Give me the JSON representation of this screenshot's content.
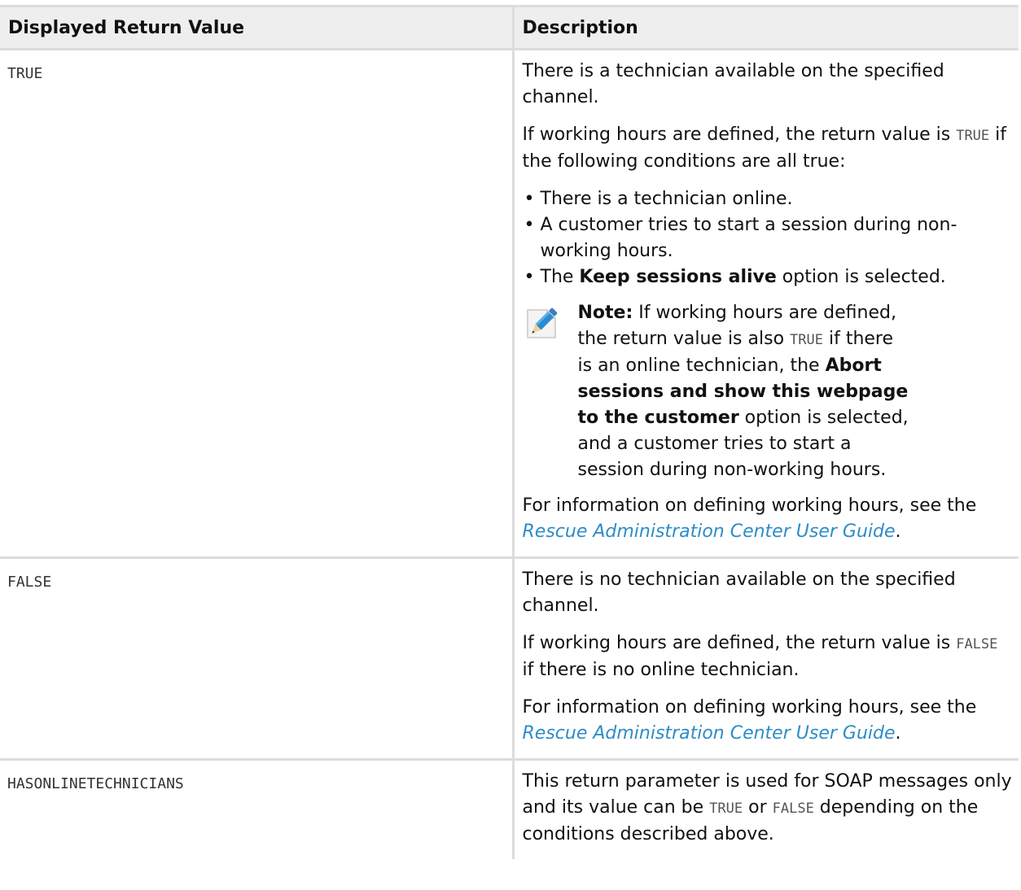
{
  "table": {
    "headers": {
      "value": "Displayed Return Value",
      "description": "Description"
    },
    "rows": [
      {
        "value": "TRUE",
        "p1": "There is a technician available on the specified channel.",
        "p2_before": "If working hours are defined, the return value is ",
        "p2_code": "TRUE",
        "p2_after": " if the following conditions are all true:",
        "bullets": [
          "There is a technician online.",
          "A customer tries to start a session during non-working hours."
        ],
        "bullet3_before": "The ",
        "bullet3_bold": "Keep sessions alive",
        "bullet3_after": " option is selected.",
        "note": {
          "label": "Note:",
          "t1": " If working hours are defined, the return value is also ",
          "code": "TRUE",
          "t2": " if there is an online technician, the ",
          "bold": "Abort sessions and show this webpage to the customer",
          "t3": " option is selected, and a customer tries to start a session during non-working hours."
        },
        "info_before": "For information on defining working hours, see the ",
        "info_link": "Rescue Administration Center User Guide",
        "info_after": "."
      },
      {
        "value": "FALSE",
        "p1": "There is no technician available on the specified channel.",
        "p2_before": "If working hours are defined, the return value is ",
        "p2_code": "FALSE",
        "p2_after": " if there is no online technician.",
        "info_before": "For information on defining working hours, see the ",
        "info_link": "Rescue Administration Center User Guide",
        "info_after": "."
      },
      {
        "value": "HASONLINETECHNICIANS",
        "t1": "This return parameter is used for SOAP messages only and its value can be ",
        "code1": "TRUE",
        "t2": " or ",
        "code2": "FALSE",
        "t3": " depending on the conditions described above."
      }
    ]
  },
  "icons": {
    "note": "pencil-note-icon"
  },
  "colors": {
    "header_bg": "#eeeeee",
    "border": "#dcdcdc",
    "link": "#2e8cc7"
  }
}
